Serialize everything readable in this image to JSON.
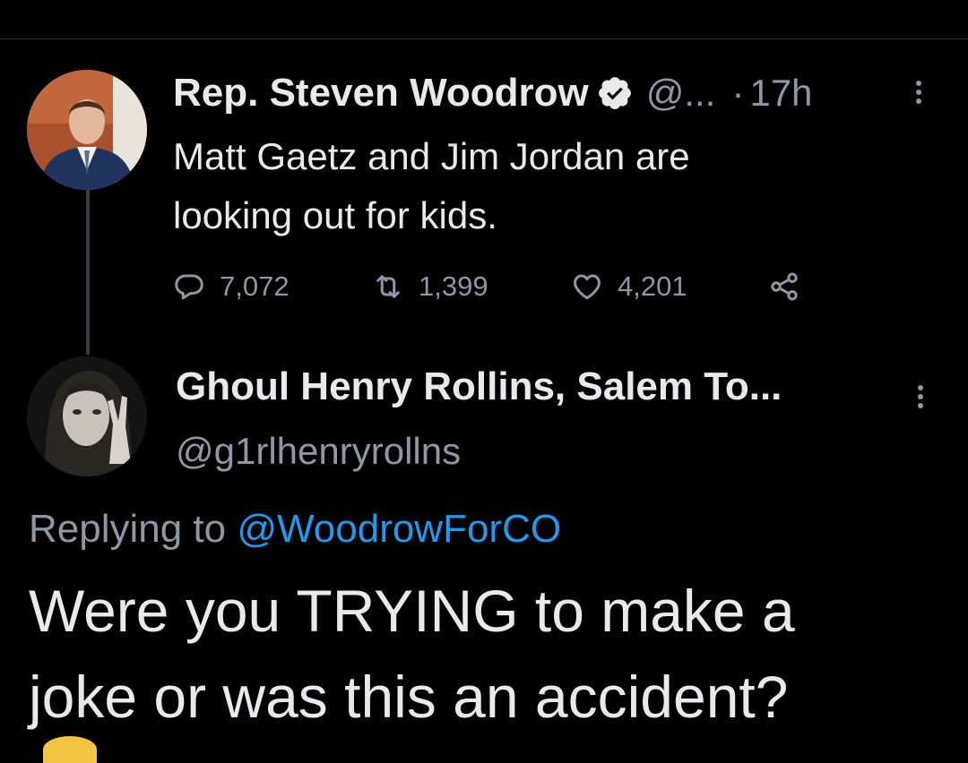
{
  "parent_tweet": {
    "display_name": "Rep. Steven Woodrow",
    "handle": "@...",
    "separator": "·",
    "time": "17h",
    "text_line1": "Matt Gaetz and Jim Jordan are",
    "text_line2": "looking out for kids.",
    "actions": {
      "replies": "7,072",
      "retweets": "1,399",
      "likes": "4,201"
    }
  },
  "reply_tweet": {
    "display_name": "Ghoul Henry Rollins, Salem To...",
    "handle": "@g1rlhenryrollns",
    "replying_prefix": "Replying to",
    "replying_to": "@WoodrowForCO",
    "text_line1": "Were you TRYING to make a",
    "text_line2": "joke or was this an accident?"
  },
  "colors": {
    "background": "#000000",
    "primary_text": "#e7e9ea",
    "secondary_text": "#8b98a5",
    "link": "#1d9bf0",
    "divider": "#2f3336"
  }
}
